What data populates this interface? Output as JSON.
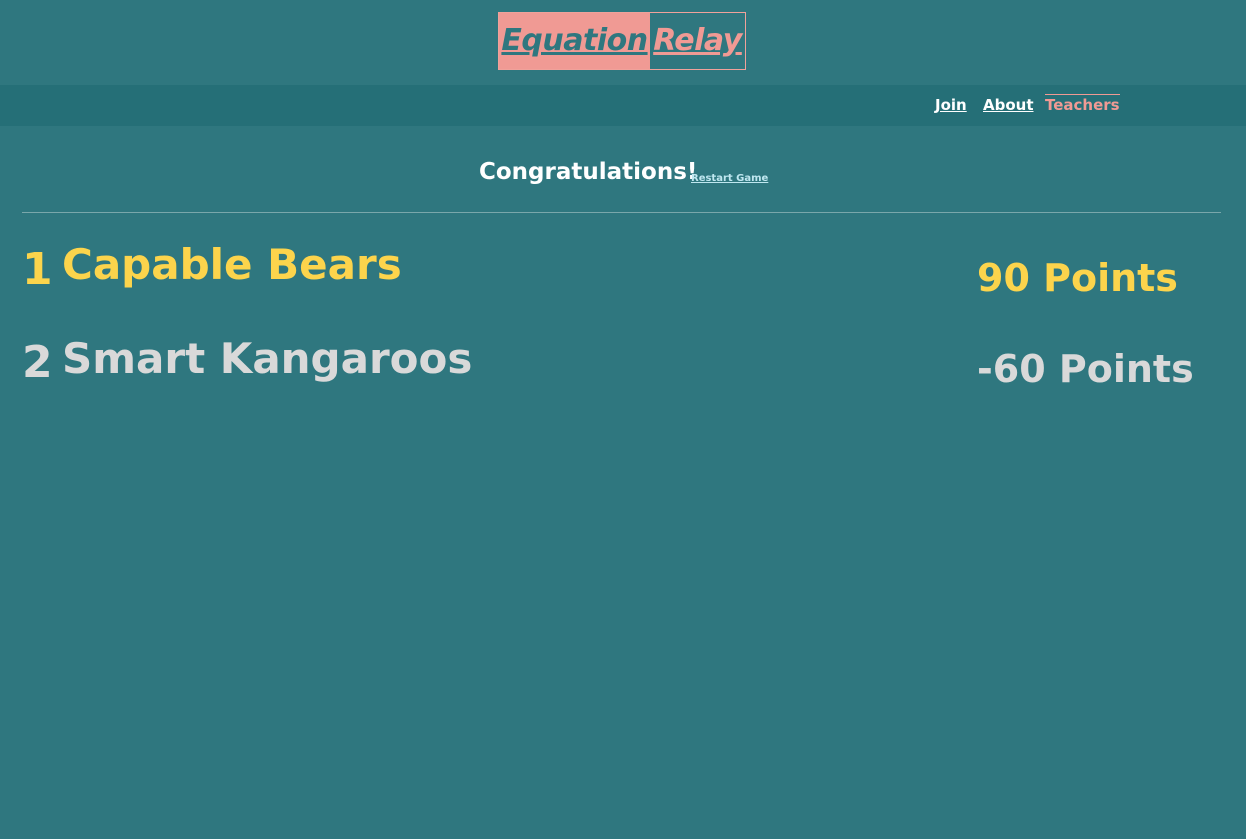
{
  "header": {
    "logo_part_1": "Equation",
    "logo_part_2": "Relay"
  },
  "nav": {
    "join": "Join",
    "about": "About",
    "teachers": "Teachers"
  },
  "results": {
    "title": "Congratulations!",
    "restart_label": "Restart Game"
  },
  "standings": [
    {
      "rank": "1",
      "team": "Capable Bears",
      "points": "90 Points"
    },
    {
      "rank": "2",
      "team": "Smart Kangaroos",
      "points": "-60 Points"
    }
  ],
  "colors": {
    "background": "#2f777f",
    "navbar": "#256f77",
    "accent_pink": "#f09a94",
    "first_place": "#fcd44c",
    "second_place": "#d9d9d9"
  }
}
